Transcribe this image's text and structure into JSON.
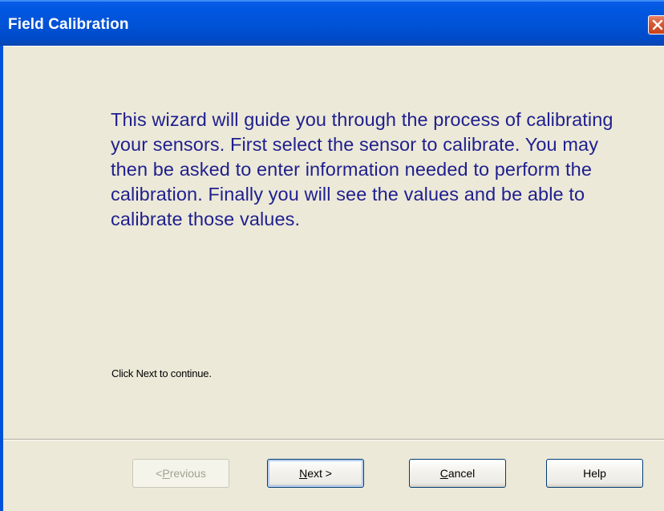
{
  "window": {
    "title": "Field Calibration",
    "close_icon": "close-icon",
    "title_bar_color": "#0054E3",
    "close_button_color": "#D85A36",
    "background_color": "#ECE9D8"
  },
  "wizard": {
    "intro_text": "This wizard will guide you through the process of calibrating your sensors. First select the sensor to calibrate. You may then be asked to enter information needed to perform the calibration. Finally you will see the values and be able to calibrate those values.",
    "intro_text_color": "#1F1F8E",
    "hint_text": "Click Next to continue."
  },
  "buttons": {
    "previous": {
      "prefix": "< ",
      "mnemonic": "P",
      "rest": "revious",
      "enabled": false
    },
    "next": {
      "mnemonic": "N",
      "rest": "ext >",
      "enabled": true,
      "is_default": true
    },
    "cancel": {
      "mnemonic": "C",
      "rest": "ancel",
      "enabled": true
    },
    "help": {
      "label": "Help",
      "enabled": true
    }
  }
}
